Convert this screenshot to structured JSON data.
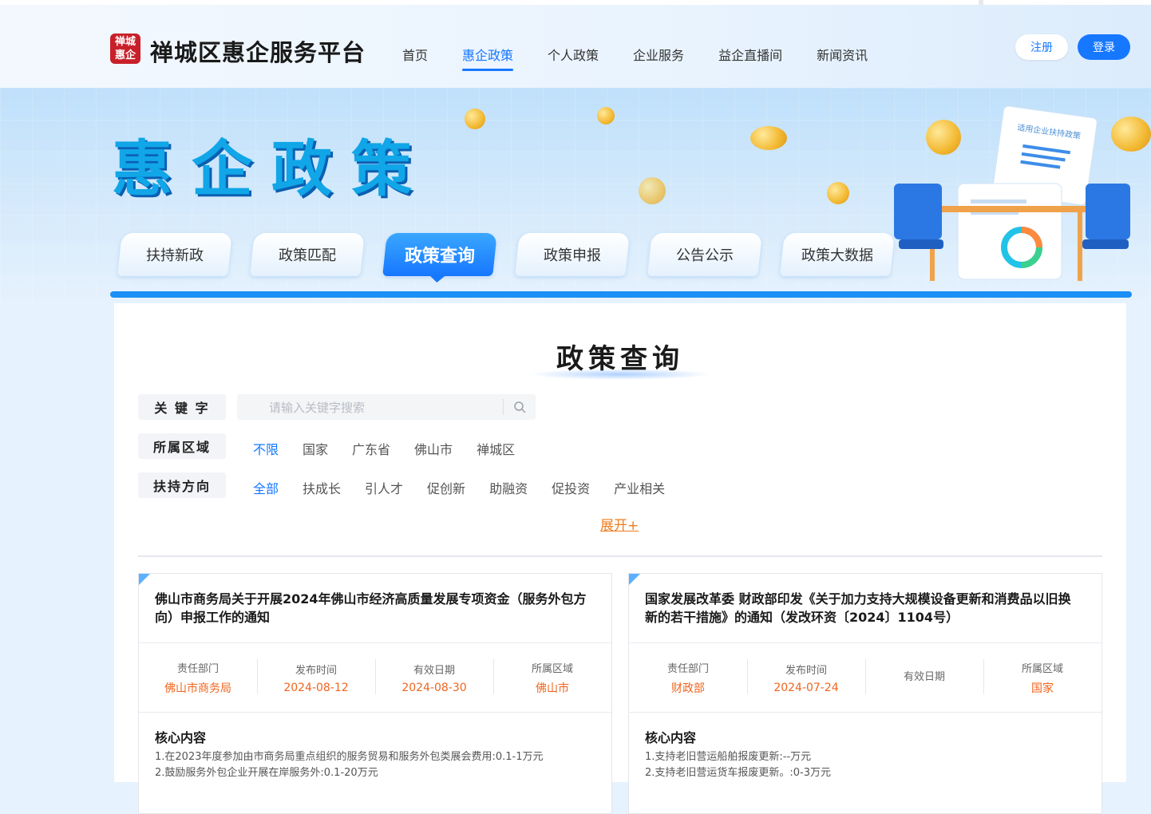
{
  "header": {
    "logo_text": "禅城惠企",
    "site_title": "禅城区惠企服务平台",
    "nav": [
      "首页",
      "惠企政策",
      "个人政策",
      "企业服务",
      "益企直播间",
      "新闻资讯"
    ],
    "nav_active_index": 1,
    "register_label": "注册",
    "login_label": "登录"
  },
  "banner": {
    "title": "惠企政策",
    "tabs": [
      "扶持新政",
      "政策匹配",
      "政策查询",
      "政策申报",
      "公告公示",
      "政策大数据"
    ],
    "active_tab_index": 2,
    "doc_heading": "适用企业扶持政策"
  },
  "query": {
    "title": "政策查询",
    "keyword_label": "关 键 字",
    "keyword_placeholder": "请输入关键字搜索",
    "region_label": "所属区域",
    "region_options": [
      "不限",
      "国家",
      "广东省",
      "佛山市",
      "禅城区"
    ],
    "region_active_index": 0,
    "direction_label": "扶持方向",
    "direction_options": [
      "全部",
      "扶成长",
      "引人才",
      "促创新",
      "助融资",
      "促投资",
      "产业相关"
    ],
    "direction_active_index": 0,
    "expand_label": "展开+"
  },
  "meta_labels": [
    "责任部门",
    "发布时间",
    "有效日期",
    "所属区域"
  ],
  "core_label": "核心内容",
  "cards": [
    {
      "title": "佛山市商务局关于开展2024年佛山市经济高质量发展专项资金（服务外包方向）申报工作的通知",
      "department": "佛山市商务局",
      "publish_date": "2024-08-12",
      "valid_date": "2024-08-30",
      "region": "佛山市",
      "core_lines": [
        "1.在2023年度参加由市商务局重点组织的服务贸易和服务外包类展会费用:0.1-1万元",
        "2.鼓励服务外包企业开展在岸服务外:0.1-20万元"
      ]
    },
    {
      "title": "国家发展改革委 财政部印发《关于加力支持大规模设备更新和消费品以旧换新的若干措施》的通知（发改环资〔2024〕1104号）",
      "department": "财政部",
      "publish_date": "2024-07-24",
      "valid_date": "",
      "region": "国家",
      "core_lines": [
        "1.支持老旧营运船舶报废更新:--万元",
        "2.支持老旧营运货车报废更新。:0-3万元"
      ]
    }
  ],
  "colors": {
    "accent": "#1677ff",
    "orange": "#f0651f",
    "banner_title": "#10a6e8"
  }
}
